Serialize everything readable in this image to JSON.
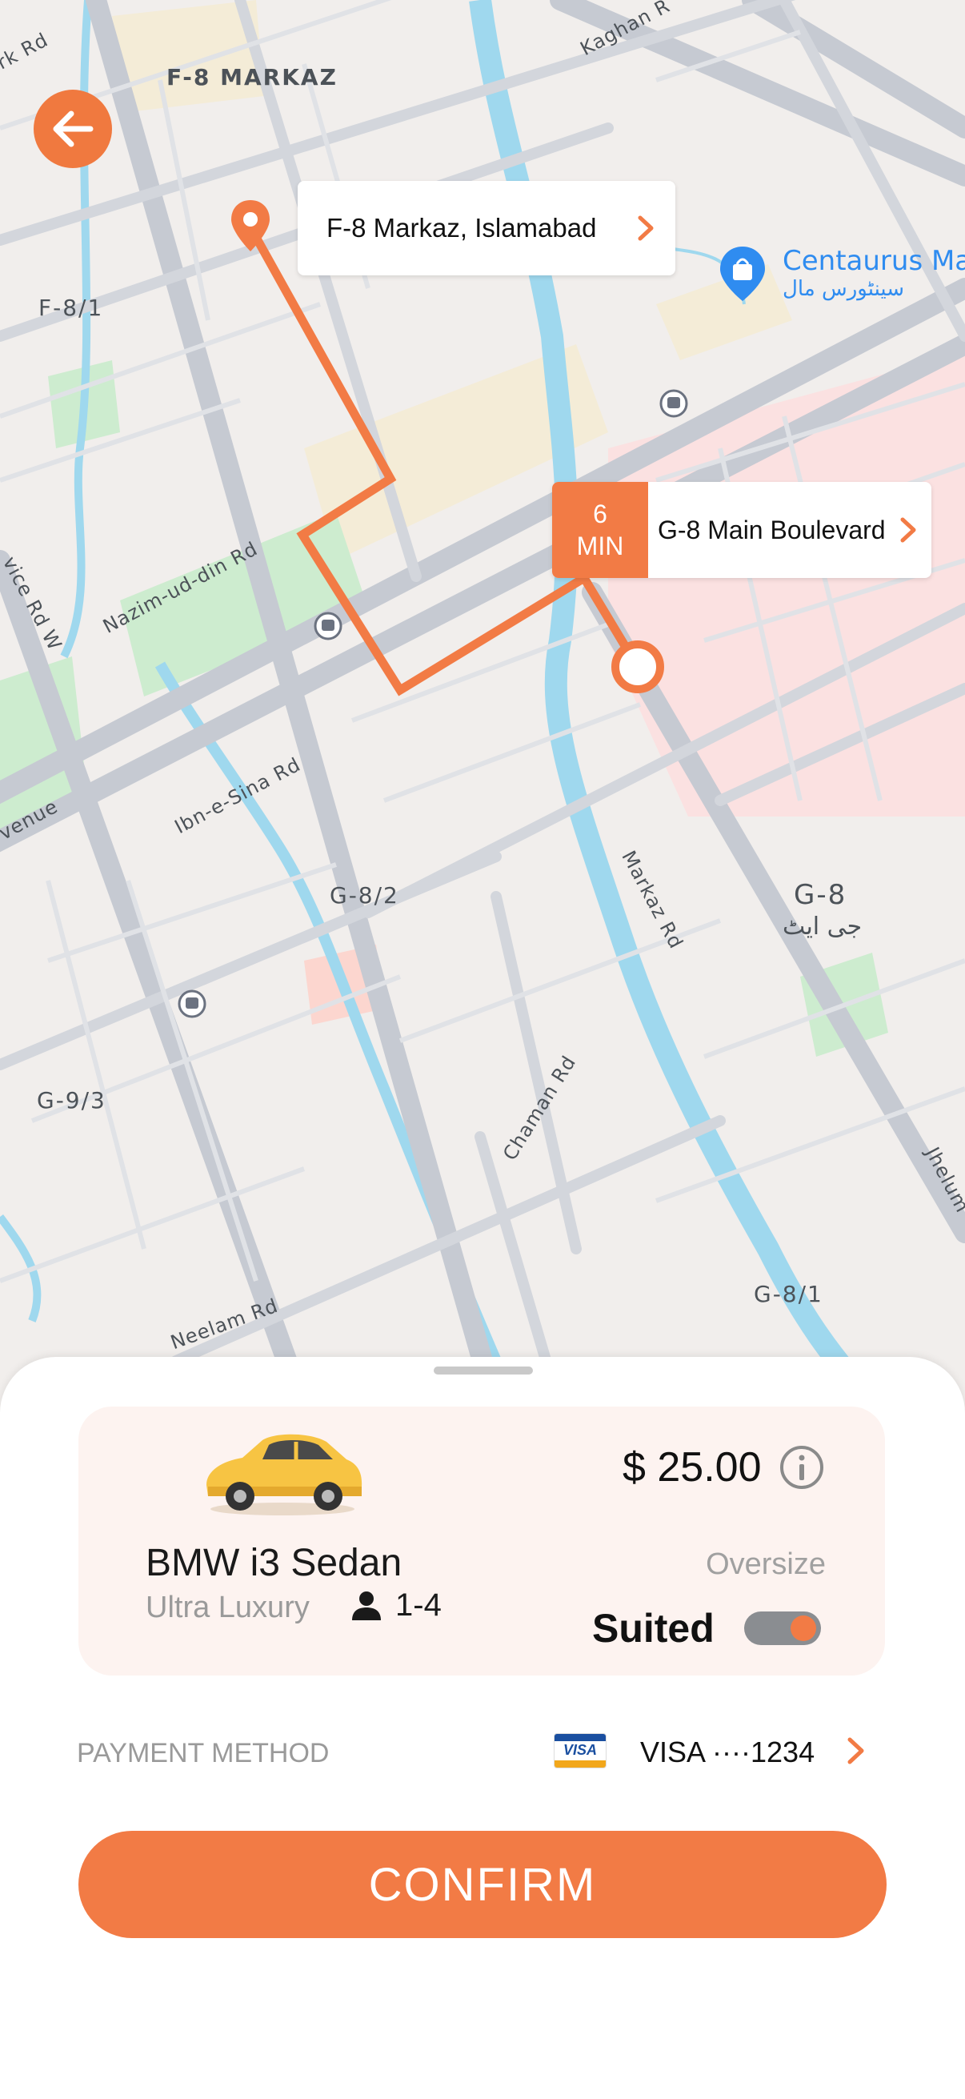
{
  "colors": {
    "accent": "#f27b45",
    "map_bg": "#f1eeec",
    "water": "#9fd8ee",
    "park": "#cdeccf"
  },
  "map": {
    "labels": {
      "f8_markaz": "F-8 MARKAZ",
      "f8_1": "F-8/1",
      "centaurus": "Centaurus Ma",
      "centaurus_urdu": "سینٹورس مال",
      "g8_2": "G-8/2",
      "g8": "G-8",
      "g8_urdu": "جی ایٹ",
      "g9_3": "G-9/3",
      "g8_1": "G-8/1",
      "nazim": "Nazim-ud-din Rd",
      "ibn_sina": "Ibn-e-Sina Rd",
      "markaz_rd": "Markaz Rd",
      "chaman_rd": "Chaman Rd",
      "neelam_rd": "Neelam Rd",
      "jhelum": "Jhelum",
      "kaghan": "Kaghan R",
      "rk_rd": "rk Rd",
      "avenue": "venue",
      "service_rd": "vice Rd W"
    },
    "pickup": {
      "label": "F-8 Markaz, Islamabad"
    },
    "dropoff": {
      "label": "G-8 Main Boulevard",
      "eta_value": "6",
      "eta_unit": "MIN"
    }
  },
  "ride": {
    "car_name": "BMW i3 Sedan",
    "car_class": "Ultra Luxury",
    "seats": "1-4",
    "price": "$ 25.00",
    "oversize_label": "Oversize",
    "suited_label": "Suited",
    "oversize_toggle_on": true
  },
  "payment": {
    "label": "PAYMENT METHOD",
    "card_brand": "VISA",
    "card_value": "VISA ····1234"
  },
  "confirm_label": "CONFIRM",
  "icons": [
    "back-arrow-icon",
    "pin-icon",
    "chevron-right-icon",
    "bus-stop-icon",
    "info-icon",
    "person-icon",
    "visa-icon",
    "car-icon",
    "shopping-bag-icon"
  ]
}
